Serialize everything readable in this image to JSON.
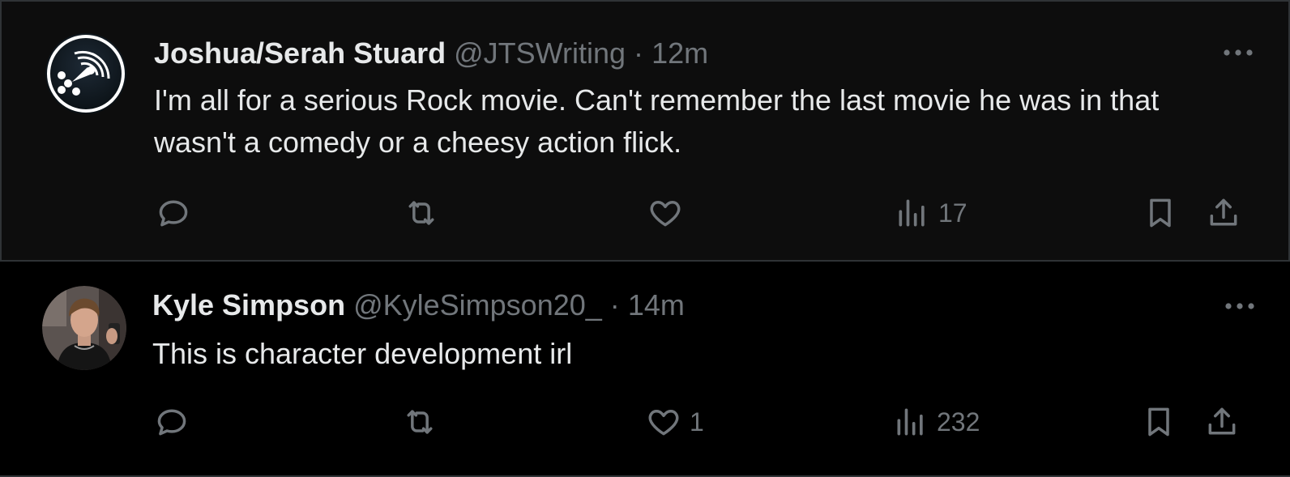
{
  "tweets": [
    {
      "name": "Joshua/Serah Stuard",
      "handle": "@JTSWriting",
      "separator": "·",
      "time": "12m",
      "text": "I'm all for a serious Rock movie. Can't remember the last movie he was in that wasn't a comedy or a cheesy action flick.",
      "likes": "",
      "views": "17",
      "avatar_icon": "satellite-dish-logo"
    },
    {
      "name": "Kyle Simpson",
      "handle": "@KyleSimpson20_",
      "separator": "·",
      "time": "14m",
      "text": "This is character development irl",
      "likes": "1",
      "views": "232",
      "avatar_icon": "profile-photo"
    }
  ],
  "icons": {
    "reply": "reply-icon",
    "retweet": "retweet-icon",
    "like": "heart-icon",
    "views": "views-icon",
    "bookmark": "bookmark-icon",
    "share": "share-icon",
    "more": "more-icon"
  },
  "colors": {
    "background": "#000000",
    "card_background": "#0d0d0d",
    "text": "#e7e9ea",
    "muted": "#71767b",
    "border": "#2f3336"
  }
}
